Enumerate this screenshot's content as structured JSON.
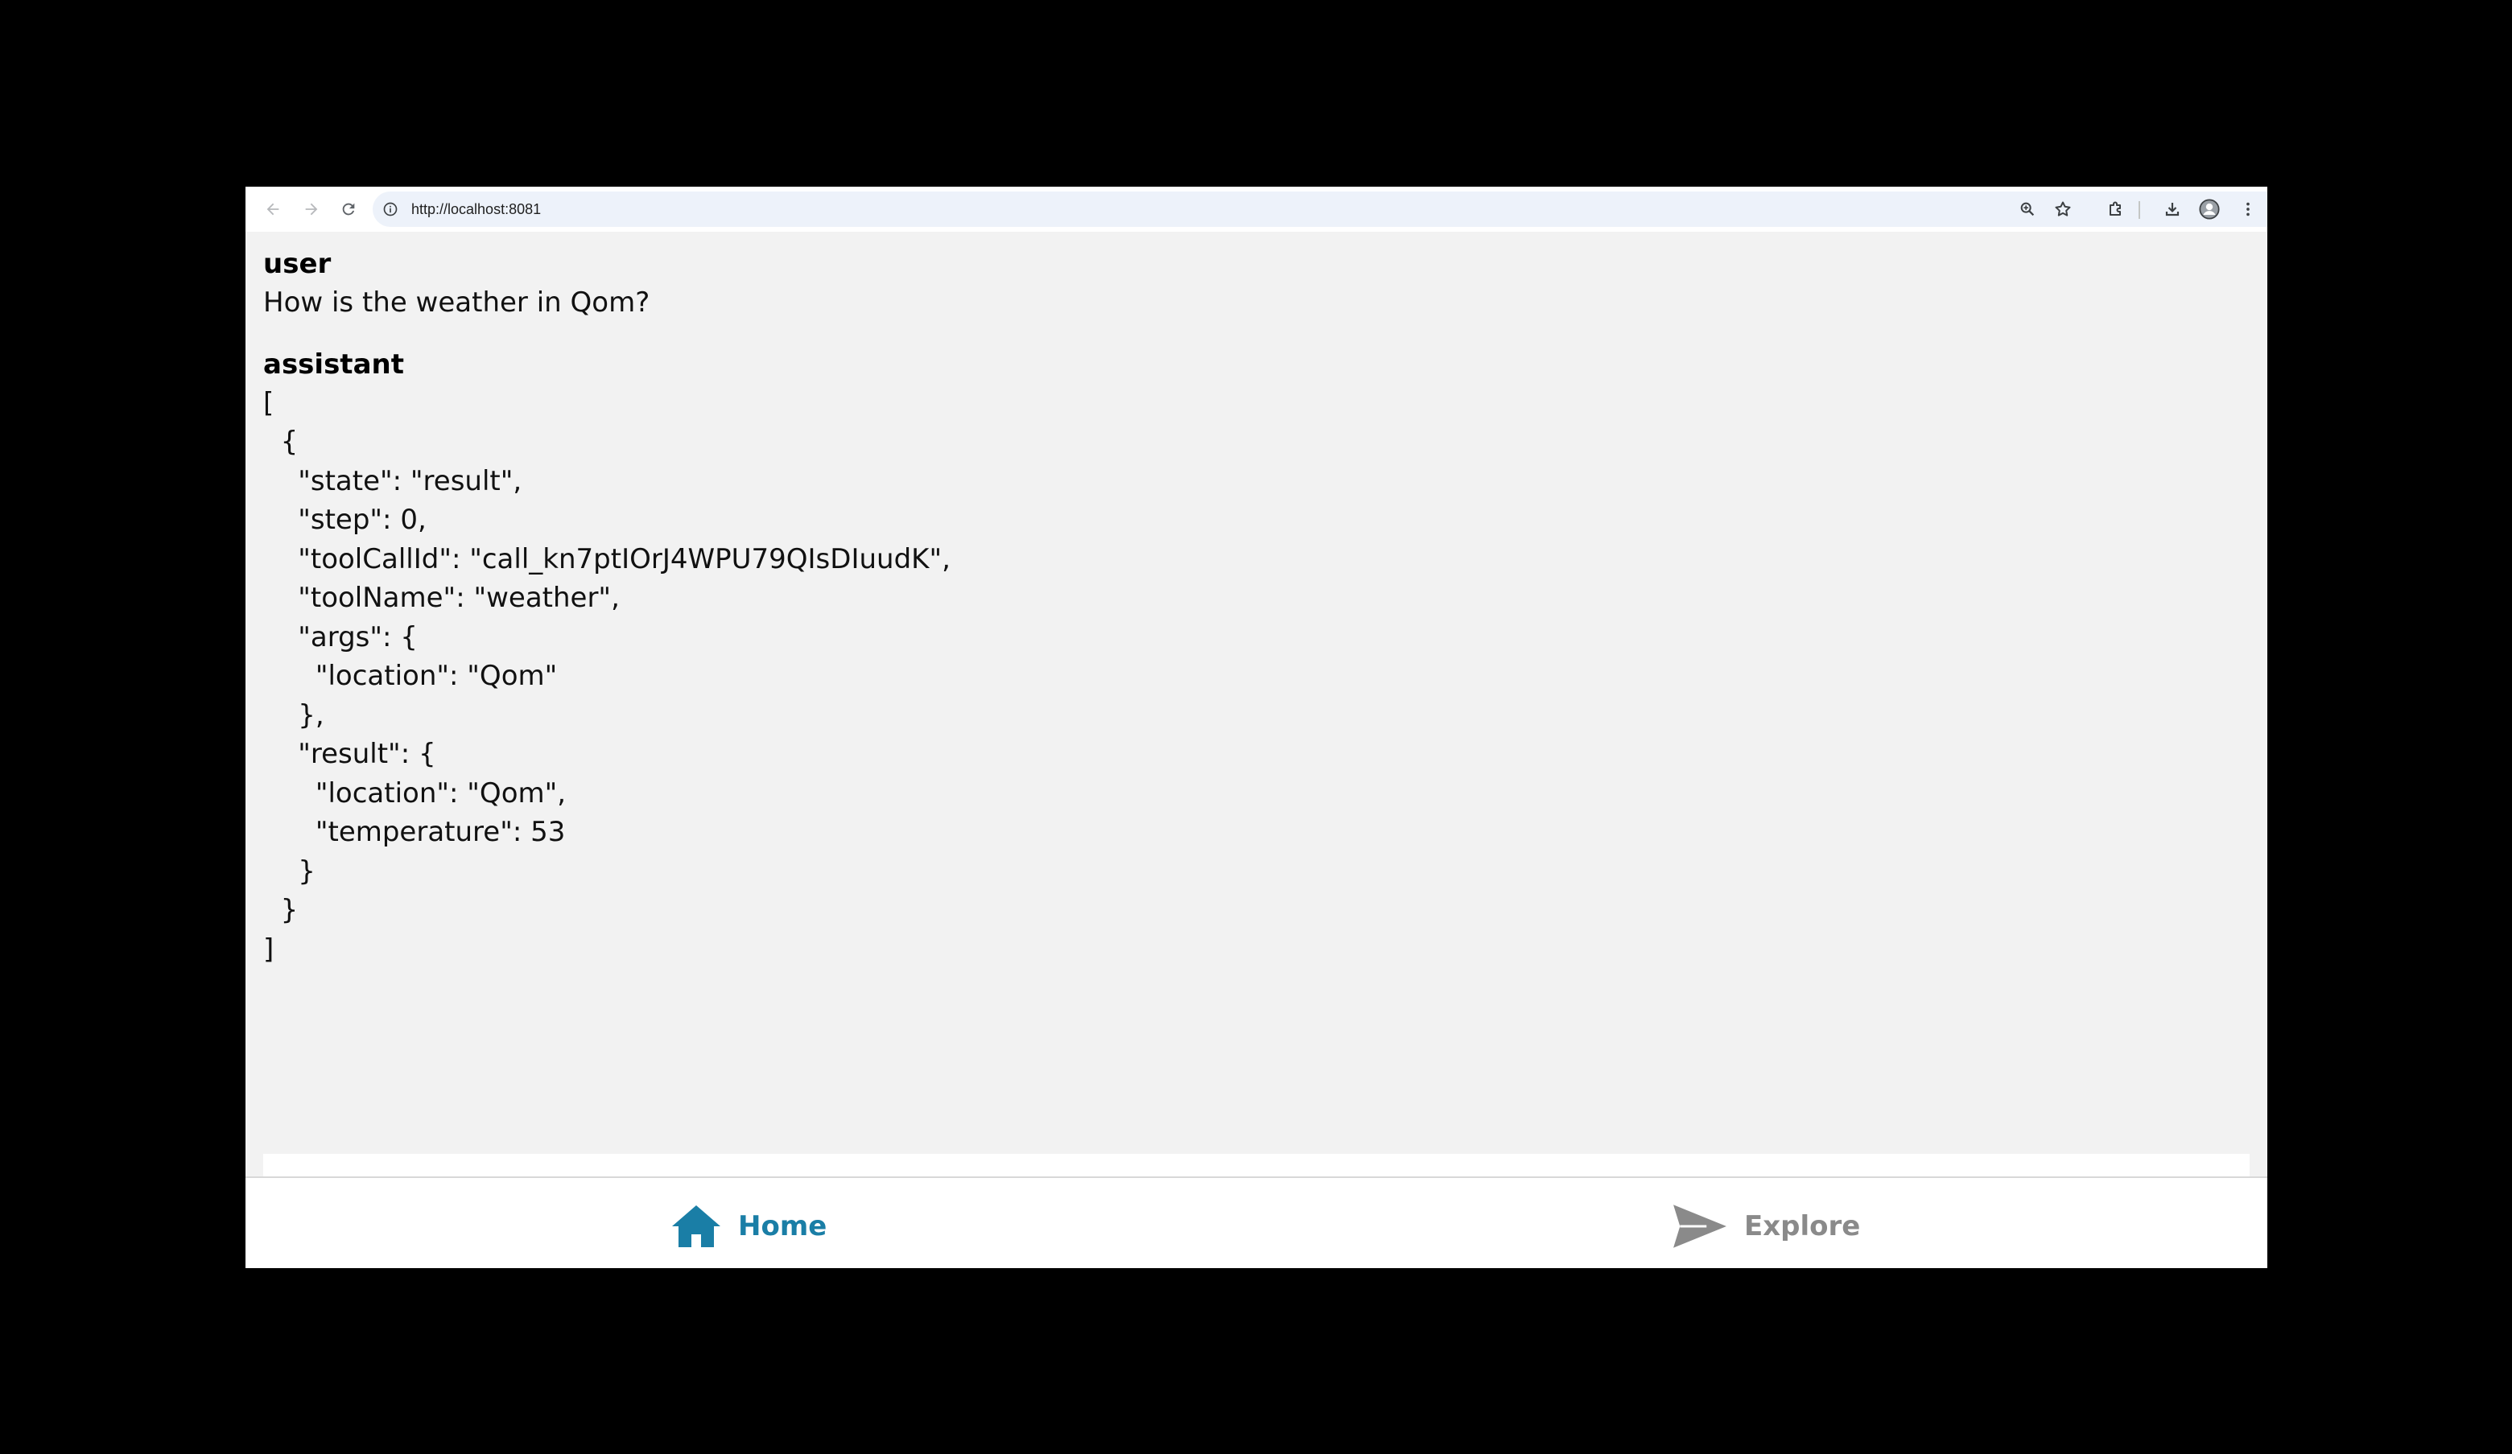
{
  "browser": {
    "url": "http://localhost:8081",
    "icons": {
      "back": "arrow-left-icon",
      "forward": "arrow-right-icon",
      "reload": "reload-icon",
      "site_info": "info-icon",
      "zoom": "zoom-icon",
      "bookmark": "star-icon",
      "extensions": "puzzle-icon",
      "downloads": "download-icon",
      "profile": "avatar-icon",
      "menu": "kebab-menu-icon"
    }
  },
  "messages": [
    {
      "role": "user",
      "content": "How is the weather in Qom?"
    },
    {
      "role": "assistant",
      "content": "[\n  {\n    \"state\": \"result\",\n    \"step\": 0,\n    \"toolCallId\": \"call_kn7ptIOrJ4WPU79QIsDIuudK\",\n    \"toolName\": \"weather\",\n    \"args\": {\n      \"location\": \"Qom\"\n    },\n    \"result\": {\n      \"location\": \"Qom\",\n      \"temperature\": 53\n    }\n  }\n]"
    }
  ],
  "tabs": [
    {
      "label": "Home",
      "icon": "home-icon",
      "active": true,
      "color": "#1a7ea6"
    },
    {
      "label": "Explore",
      "icon": "send-icon",
      "active": false,
      "color": "#8a8a8a"
    }
  ]
}
